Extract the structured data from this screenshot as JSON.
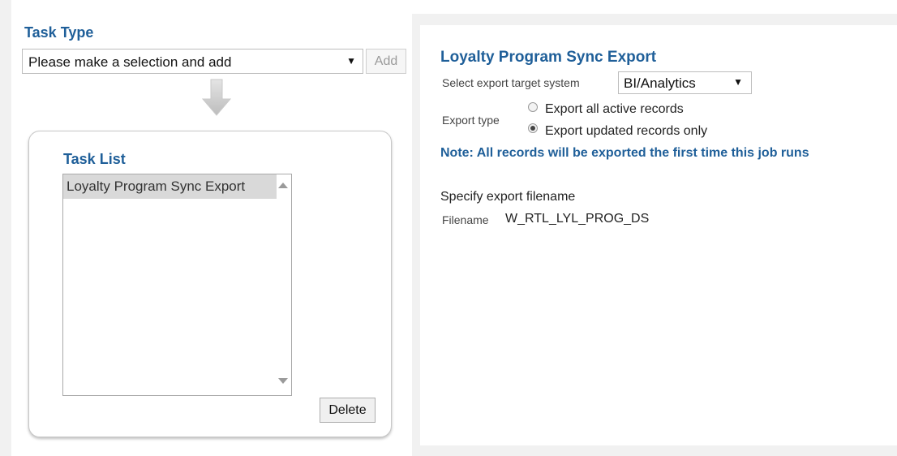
{
  "task_type": {
    "title": "Task Type",
    "select_value": "Please make a selection and add",
    "add_label": "Add"
  },
  "task_list": {
    "title": "Task List",
    "items": [
      {
        "label": "Loyalty Program Sync Export"
      }
    ],
    "delete_label": "Delete"
  },
  "export": {
    "title": "Loyalty Program Sync Export",
    "target_label": "Select export target system",
    "target_value": "BI/Analytics",
    "type_label": "Export type",
    "options": [
      {
        "label": "Export all active records",
        "checked": false
      },
      {
        "label": "Export updated records only",
        "checked": true
      }
    ],
    "note": "Note: All records will be exported the first time this job runs",
    "spec_label": "Specify export filename",
    "filename_label": "Filename",
    "filename_value": "W_RTL_LYL_PROG_DS"
  },
  "colors": {
    "heading": "#1f5f99",
    "panel_bg": "#f1f1f1",
    "selected_item": "#d9d9d9"
  },
  "icons": {
    "caret": "▼",
    "flow_arrow": "down-arrow-icon"
  }
}
